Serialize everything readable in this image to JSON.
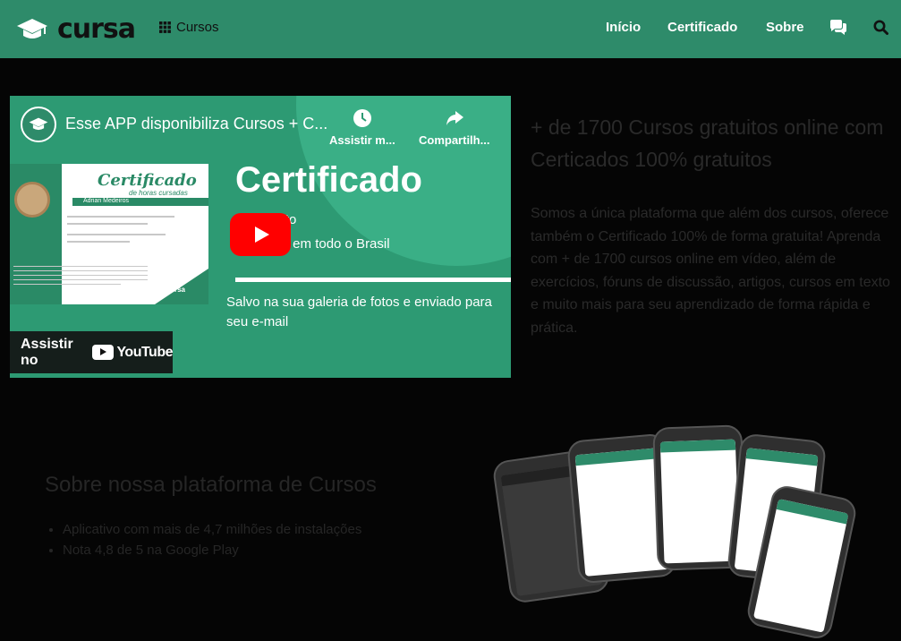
{
  "brand": {
    "name": "cursa"
  },
  "nav": {
    "cursos": "Cursos",
    "inicio": "Início",
    "certificado": "Certificado",
    "sobre": "Sobre"
  },
  "video": {
    "title": "Esse APP disponibiliza Cursos + C...",
    "watch_later": "Assistir m...",
    "share": "Compartilh...",
    "cert_heading": "Certificado",
    "cert_subheading": "de horas cursadas",
    "cert_name": "Adrian Medeiros",
    "cert_brand": "cursa",
    "big_title": "Certificado",
    "line_gratuito": "tuito",
    "line_brasil": "ido em todo o Brasil",
    "saved_text": "Salvo na sua galeria de fotos e enviado para seu e-mail",
    "watch_on": "Assistir no",
    "youtube": "YouTube"
  },
  "hero": {
    "headline": "+ de 1700 Cursos gratuitos online com Certicados 100% gratuitos",
    "paragraph": "Somos a única plataforma que além dos cursos, oferece também o Certificado 100% de forma gratuita! Aprenda com + de 1700 cursos online em vídeo, além de exercícios, fóruns de discussão, artigos, cursos em texto e muito mais para seu aprendizado de forma rápida e prática."
  },
  "about": {
    "title": "Sobre nossa plataforma de Cursos",
    "bullets": [
      "Aplicativo com mais de 4,7 milhões de instalações",
      "Nota 4,8 de 5 na Google Play"
    ]
  },
  "colors": {
    "header_bg": "#2e8b6a",
    "youtube_red": "#ff0000"
  }
}
